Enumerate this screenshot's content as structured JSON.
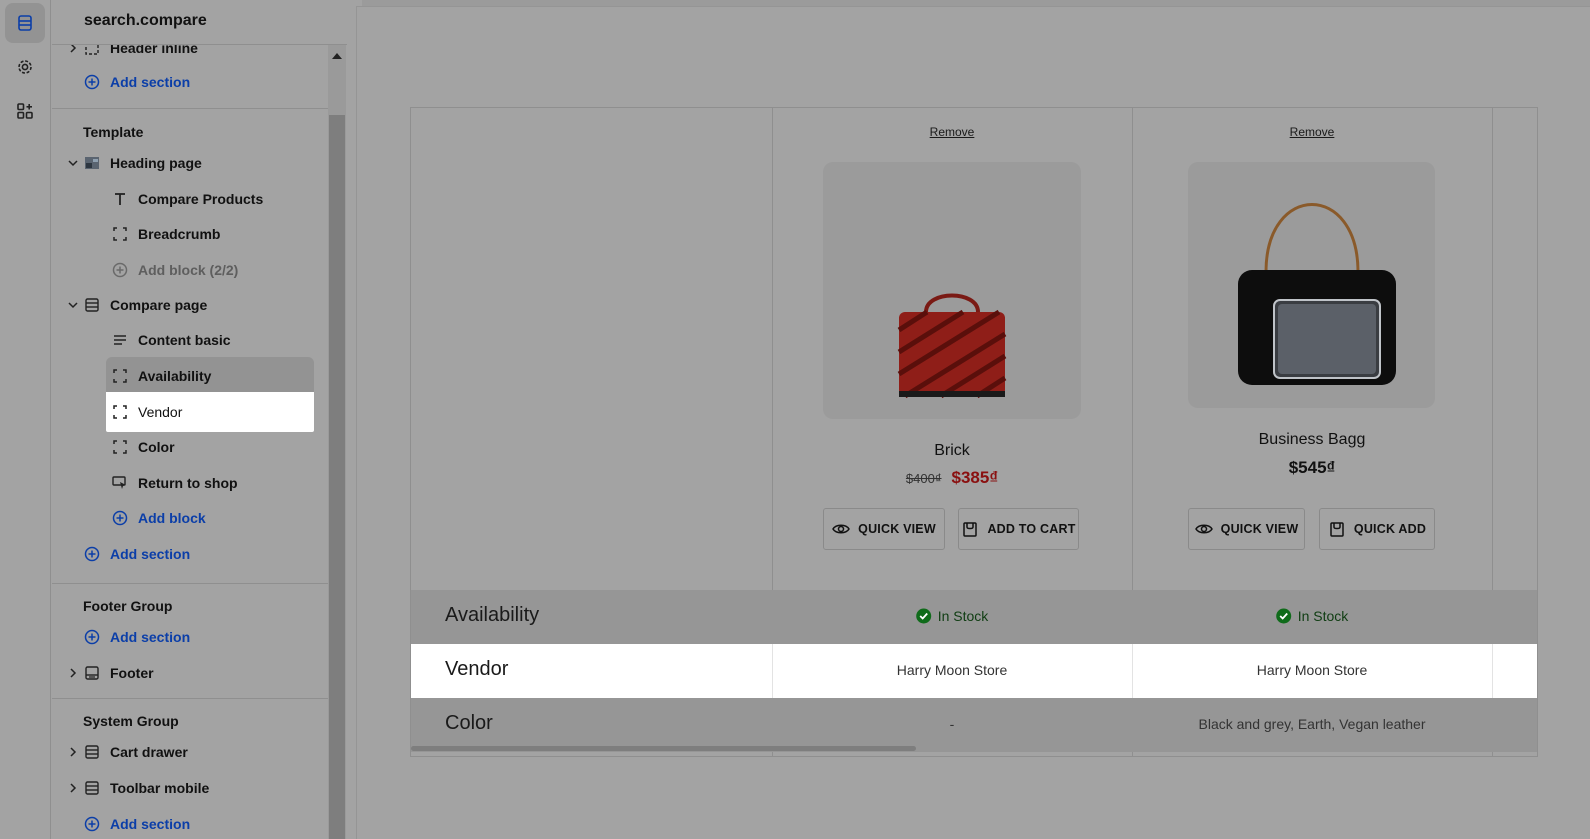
{
  "rail": {
    "items": [
      {
        "name": "sections-icon",
        "active": true
      },
      {
        "name": "settings-icon",
        "active": false
      },
      {
        "name": "apps-icon",
        "active": false
      }
    ]
  },
  "sidebar": {
    "title": "search.compare",
    "header_partial": "Header inline",
    "add_section_label": "Add section",
    "template_title": "Template",
    "heading_page": {
      "label": "Heading page",
      "blocks": [
        "Compare Products",
        "Breadcrumb"
      ],
      "add_block_disabled": "Add block (2/2)"
    },
    "compare_page": {
      "label": "Compare page",
      "blocks": [
        "Content basic",
        "Availability",
        "Vendor",
        "Color",
        "Return to shop"
      ],
      "add_block": "Add block"
    },
    "footer_group_title": "Footer Group",
    "footer_label": "Footer",
    "system_group_title": "System Group",
    "cart_drawer_label": "Cart drawer",
    "toolbar_mobile_label": "Toolbar mobile"
  },
  "compare": {
    "products": [
      {
        "remove": "Remove",
        "name": "Brick",
        "old_price": "$400₫",
        "price": "$385₫",
        "on_sale": true,
        "btn1": "QUICK VIEW",
        "btn2": "ADD TO CART"
      },
      {
        "remove": "Remove",
        "name": "Business Bagg",
        "price": "$545₫",
        "on_sale": false,
        "btn1": "QUICK VIEW",
        "btn2": "QUICK ADD"
      }
    ],
    "rows": {
      "availability": {
        "label": "Availability",
        "values": [
          "In Stock",
          "In Stock"
        ]
      },
      "vendor": {
        "label": "Vendor",
        "values": [
          "Harry Moon Store",
          "Harry Moon Store"
        ]
      },
      "color": {
        "label": "Color",
        "values": [
          "-",
          "Black and grey, Earth, Vegan leather"
        ]
      }
    }
  },
  "colors": {
    "accent_blue": "#0b3ea8",
    "sale_red": "#8a1010",
    "stock_green": "#0f6b1a"
  }
}
